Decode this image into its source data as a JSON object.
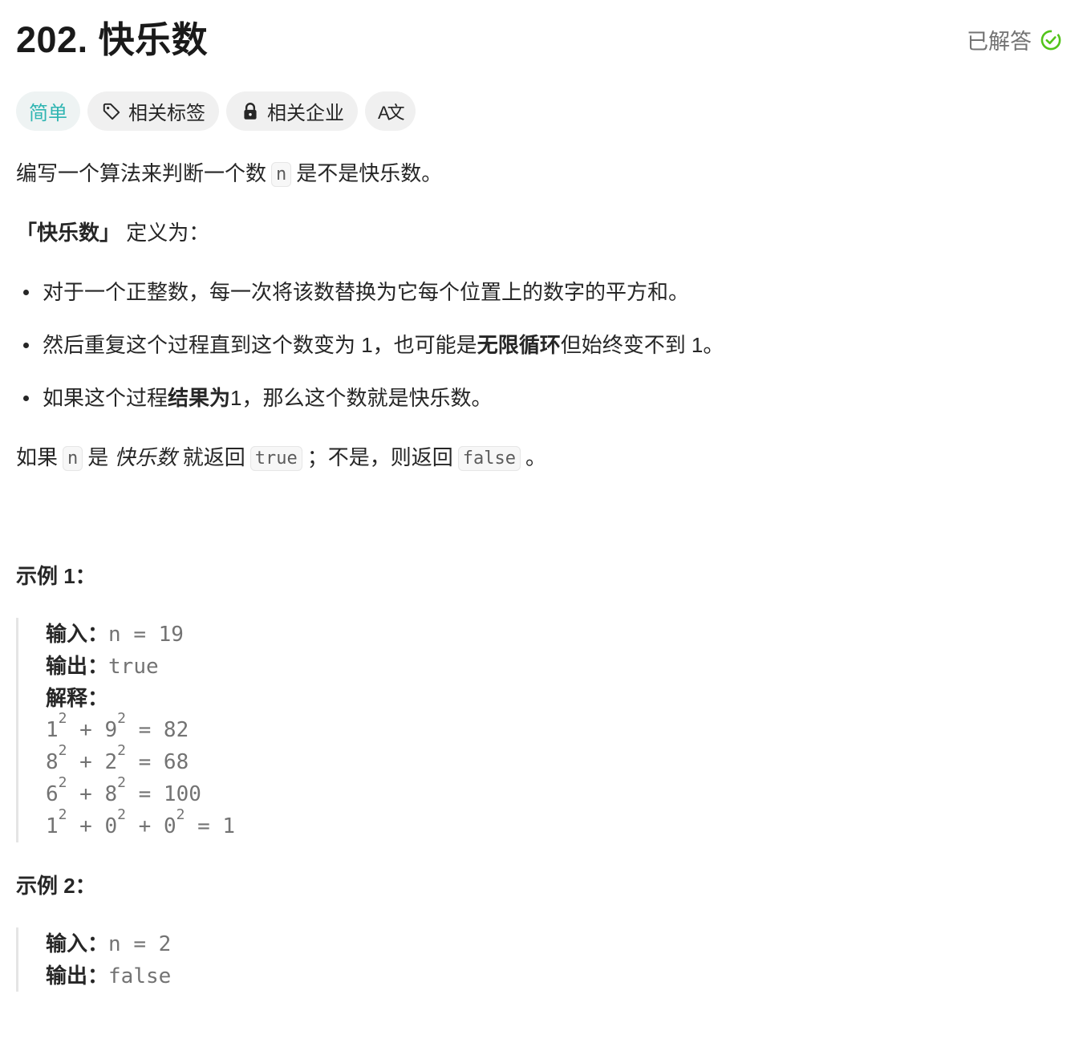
{
  "header": {
    "title": "202. 快乐数",
    "solved_label": "已解答",
    "solved_icon": "check-circle-icon",
    "solved_color": "#52c41a"
  },
  "tags": {
    "difficulty": "简单",
    "difficulty_color": "#2fb5b2",
    "related_tags": "相关标签",
    "related_companies": "相关企业",
    "translate_glyph": "A文"
  },
  "description": {
    "line1_pre": "编写一个算法来判断一个数",
    "line1_code": "n",
    "line1_post": "是不是快乐数。",
    "def_bold": "「快乐数」",
    "def_rest": " 定义为：",
    "bullet1": "对于一个正整数，每一次将该数替换为它每个位置上的数字的平方和。",
    "bullet2_pre": "然后重复这个过程直到这个数变为 1，也可能是 ",
    "bullet2_bold": "无限循环",
    "bullet2_post": " 但始终变不到 1。",
    "bullet3_pre": "如果这个过程 ",
    "bullet3_bold": "结果为",
    "bullet3_post": " 1，那么这个数就是快乐数。",
    "ret_pre": "如果",
    "ret_code_n": "n",
    "ret_mid1": "是 ",
    "ret_italic": "快乐数",
    "ret_mid2": " 就返回",
    "ret_code_true": "true",
    "ret_mid3": "；不是，则返回",
    "ret_code_false": "false",
    "ret_end": "。"
  },
  "example1": {
    "title": "示例 1：",
    "input_label": "输入：",
    "input_value": "n = 19",
    "output_label": "输出：",
    "output_value": "true",
    "explain_label": "解释：",
    "steps": [
      {
        "a": "1",
        "b": "9",
        "c": null,
        "result": "82"
      },
      {
        "a": "8",
        "b": "2",
        "c": null,
        "result": "68"
      },
      {
        "a": "6",
        "b": "8",
        "c": null,
        "result": "100"
      },
      {
        "a": "1",
        "b": "0",
        "c": "0",
        "result": "1"
      }
    ],
    "exponent": "2"
  },
  "example2": {
    "title": "示例 2：",
    "input_label": "输入：",
    "input_value": "n = 2",
    "output_label": "输出：",
    "output_value": "false"
  }
}
